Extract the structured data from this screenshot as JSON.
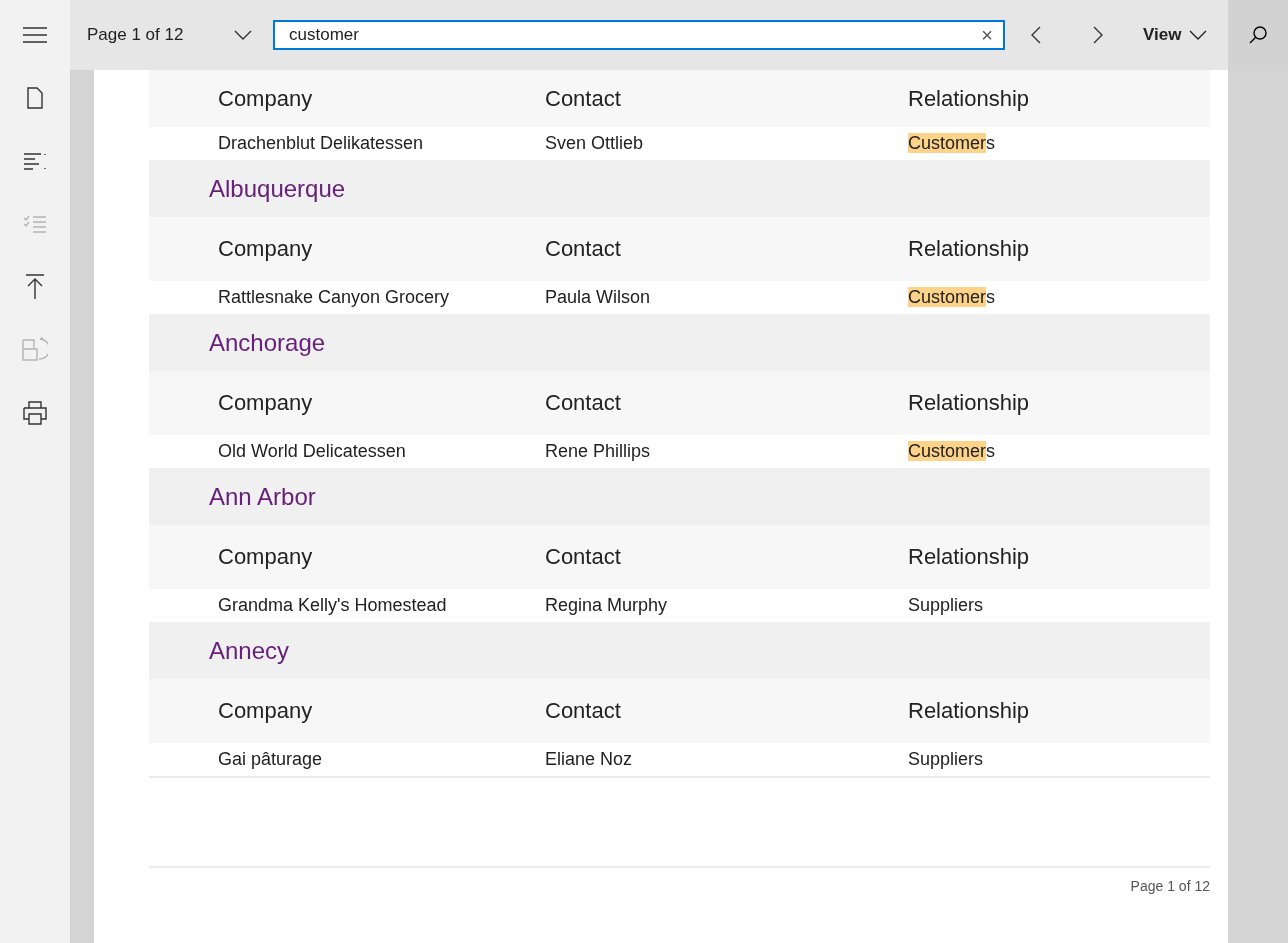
{
  "sidebar": {
    "items": [
      {
        "kind": "menu",
        "disabled": false
      },
      {
        "kind": "page",
        "disabled": false
      },
      {
        "kind": "outline",
        "disabled": false
      },
      {
        "kind": "checklist",
        "disabled": true
      },
      {
        "kind": "top",
        "disabled": false
      },
      {
        "kind": "rotate",
        "disabled": true
      },
      {
        "kind": "print",
        "disabled": false
      }
    ]
  },
  "toolbar": {
    "page_label": "Page 1 of 12",
    "search": {
      "value": "customer",
      "clear": "×"
    },
    "view_label": "View"
  },
  "report": {
    "groups": [
      {
        "columns": [
          "Company",
          "Contact",
          "Relationship"
        ],
        "row": {
          "company": "Drachenblut Delikatessen",
          "contact": "Sven Ottlieb",
          "relationship": [
            {
              "text": "Customer",
              "highlighted": true
            },
            {
              "text": "s",
              "highlighted": false
            }
          ]
        }
      },
      {
        "city": "Albuquerque",
        "columns": [
          "Company",
          "Contact",
          "Relationship"
        ],
        "row": {
          "company": "Rattlesnake Canyon Grocery",
          "contact": "Paula Wilson",
          "relationship": [
            {
              "text": "Customer",
              "highlighted": true
            },
            {
              "text": "s",
              "highlighted": false
            }
          ]
        }
      },
      {
        "city": "Anchorage",
        "columns": [
          "Company",
          "Contact",
          "Relationship"
        ],
        "row": {
          "company": "Old World Delicatessen",
          "contact": "Rene Phillips",
          "relationship": [
            {
              "text": "Customer",
              "highlighted": true
            },
            {
              "text": "s",
              "highlighted": false
            }
          ]
        }
      },
      {
        "city": "Ann Arbor",
        "columns": [
          "Company",
          "Contact",
          "Relationship"
        ],
        "row": {
          "company": "Grandma Kelly's Homestead",
          "contact": "Regina Murphy",
          "relationship": [
            {
              "text": "Suppliers",
              "highlighted": false
            }
          ]
        }
      },
      {
        "city": "Annecy",
        "columns": [
          "Company",
          "Contact",
          "Relationship"
        ],
        "row": {
          "company": "Gai pâturage",
          "contact": "Eliane Noz",
          "relationship": [
            {
              "text": "Suppliers",
              "highlighted": false
            }
          ]
        }
      }
    ],
    "footer": "Page 1 of 12"
  }
}
